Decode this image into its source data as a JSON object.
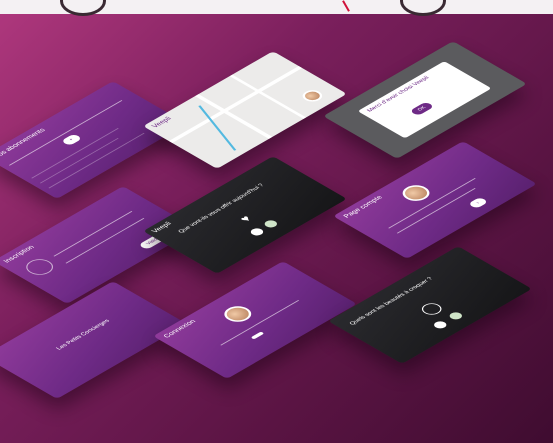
{
  "cards": {
    "abonnements": {
      "title": "Vos abonnements"
    },
    "inscription": {
      "title": "Inscription",
      "button": "Valider"
    },
    "logo": {
      "brand": "Les Petits Concierges"
    },
    "map": {
      "brand": "Veepli"
    },
    "dark_heart": {
      "brand": "Veepli",
      "question": "Que vont-ils vous offrir aujourd'hui ?"
    },
    "connexion": {
      "title": "Connexion"
    },
    "popup": {
      "title": "Merci d'avoir choisi Veepli",
      "button": "OK"
    },
    "profil": {
      "title": "Page compte"
    },
    "dark_timer": {
      "question": "Quels sont les beautés à croquer ?"
    }
  },
  "colors": {
    "accent": "#6e2a86",
    "background": "#5a1443"
  }
}
